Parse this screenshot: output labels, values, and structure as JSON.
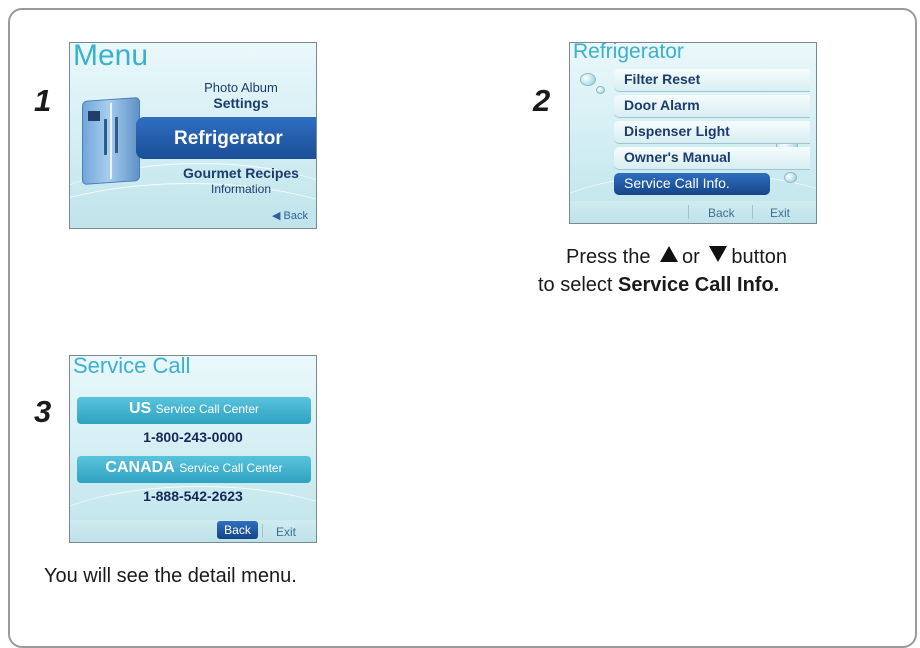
{
  "steps": [
    "1",
    "2",
    "3"
  ],
  "screen1": {
    "title": "Menu",
    "items": [
      "Photo Album",
      "Settings",
      "Refrigerator",
      "Gourmet Recipes",
      "Information"
    ],
    "selected": "Refrigerator",
    "back": "◀ Back"
  },
  "screen2": {
    "title": "Refrigerator",
    "items": [
      "Filter Reset",
      "Door Alarm",
      "Dispenser Light",
      "Owner's Manual",
      "Service Call Info."
    ],
    "selected": "Service Call Info.",
    "back": "Back",
    "exit": "Exit"
  },
  "screen3": {
    "title": "Service Call",
    "us_label": "US",
    "us_suffix": "Service Call Center",
    "us_phone": "1-800-243-0000",
    "canada_label": "CANADA",
    "canada_suffix": "Service Call Center",
    "canada_phone": "1-888-542-2623",
    "back": "Back",
    "exit": "Exit"
  },
  "captions": {
    "step2_a": "Press the",
    "step2_or": "or",
    "step2_b": "button",
    "step2_c": "to select",
    "step2_bold": "Service Call Info.",
    "step3": "You will see the detail menu."
  },
  "icons": {
    "up": "up-triangle-icon",
    "down": "down-triangle-icon",
    "fridge": "refrigerator-icon"
  }
}
